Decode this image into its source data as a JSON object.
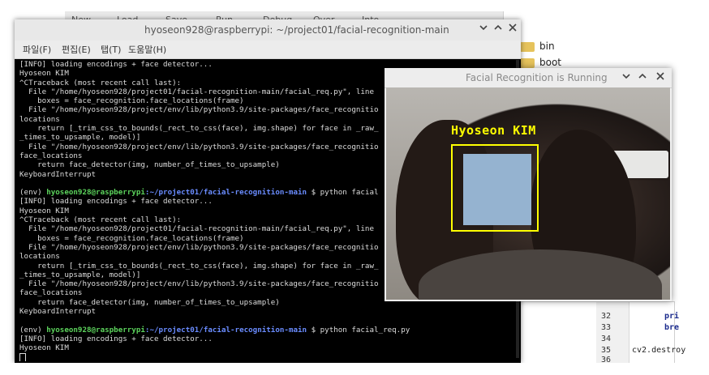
{
  "background": {
    "toolbar_items": [
      "New",
      "Load",
      "Save",
      "Run",
      "Debug",
      "Over",
      "Into"
    ],
    "folders": [
      "bin",
      "boot"
    ],
    "editor": {
      "line_numbers": [
        "32",
        "33",
        "34",
        "35",
        "36"
      ],
      "code_lines": [
        "pri",
        "bre",
        "cv2.destroy"
      ]
    }
  },
  "terminal": {
    "title": "hyoseon928@raspberrypi: ~/project01/facial-recognition-main",
    "menu": [
      "파일(F)",
      "편집(E)",
      "탭(T)",
      "도움말(H)"
    ],
    "lines": [
      {
        "text": "[INFO] loading encodings + face detector..."
      },
      {
        "text": "Hyoseon KIM"
      },
      {
        "text": "^CTraceback (most recent call last):"
      },
      {
        "text": "  File \"/home/hyoseon928/project01/facial-recognition-main/facial_req.py\", line"
      },
      {
        "text": "    boxes = face_recognition.face_locations(frame)"
      },
      {
        "text": "  File \"/home/hyoseon928/project/env/lib/python3.9/site-packages/face_recognitio"
      },
      {
        "text": "locations"
      },
      {
        "text": "    return [_trim_css_to_bounds(_rect_to_css(face), img.shape) for face in _raw_"
      },
      {
        "text": "_times_to_upsample, model)]"
      },
      {
        "text": "  File \"/home/hyoseon928/project/env/lib/python3.9/site-packages/face_recognitio"
      },
      {
        "text": "face_locations"
      },
      {
        "text": "    return face_detector(img, number_of_times_to_upsample)"
      },
      {
        "text": "KeyboardInterrupt"
      },
      {
        "text": ""
      },
      {
        "env": "(env) ",
        "user": "hyoseon928@raspberrypi",
        "path": ":~/project01/facial-recognition-main",
        "cmd": " $ python facial"
      },
      {
        "text": "[INFO] loading encodings + face detector..."
      },
      {
        "text": "Hyoseon KIM"
      },
      {
        "text": "^CTraceback (most recent call last):"
      },
      {
        "text": "  File \"/home/hyoseon928/project01/facial-recognition-main/facial_req.py\", line"
      },
      {
        "text": "    boxes = face_recognition.face_locations(frame)"
      },
      {
        "text": "  File \"/home/hyoseon928/project/env/lib/python3.9/site-packages/face_recognitio"
      },
      {
        "text": "locations"
      },
      {
        "text": "    return [_trim_css_to_bounds(_rect_to_css(face), img.shape) for face in _raw_"
      },
      {
        "text": "_times_to_upsample, model)]"
      },
      {
        "text": "  File \"/home/hyoseon928/project/env/lib/python3.9/site-packages/face_recognitio"
      },
      {
        "text": "face_locations"
      },
      {
        "text": "    return face_detector(img, number_of_times_to_upsample)"
      },
      {
        "text": "KeyboardInterrupt"
      },
      {
        "text": ""
      },
      {
        "env": "(env) ",
        "user": "hyoseon928@raspberrypi",
        "path": ":~/project01/facial-recognition-main",
        "cmd": " $ python facial_req.py"
      },
      {
        "text": "[INFO] loading encodings + face detector..."
      },
      {
        "text": "Hyoseon KIM"
      }
    ]
  },
  "face_window": {
    "title": "Facial Recognition is Running",
    "detected_name": "Hyoseon KIM",
    "box_color": "#ffff00"
  },
  "icons": {
    "minimize": "chevron-down-icon",
    "maximize": "chevron-up-icon",
    "close": "close-icon"
  }
}
